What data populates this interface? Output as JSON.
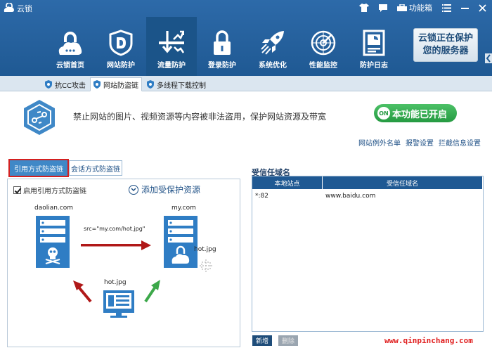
{
  "window": {
    "title": "云锁",
    "toolbox_label": "功能箱"
  },
  "nav": {
    "items": [
      {
        "label": "云锁首页",
        "icon": "cloud-lock-icon"
      },
      {
        "label": "网站防护",
        "icon": "shield-d-icon"
      },
      {
        "label": "流量防护",
        "icon": "traffic-arrows-icon"
      },
      {
        "label": "登录防护",
        "icon": "padlock-icon"
      },
      {
        "label": "系统优化",
        "icon": "rocket-icon"
      },
      {
        "label": "性能监控",
        "icon": "radar-icon"
      },
      {
        "label": "防护日志",
        "icon": "log-document-icon"
      }
    ],
    "active_index": 2
  },
  "protect_badge": {
    "line1": "云锁正在保护",
    "line2": "您的服务器"
  },
  "subtabs": [
    {
      "label": "抗CC攻击",
      "active": false
    },
    {
      "label": "网站防盗链",
      "active": true
    },
    {
      "label": "多线程下载控制",
      "active": false
    }
  ],
  "feature": {
    "description": "禁止网站的图片、视频资源等内容被非法盗用，保护网站资源及带宽",
    "toggle_badge": "ON",
    "toggle_label": "本功能已开启"
  },
  "links": {
    "whitelist": "网站例外名单",
    "alert_settings": "报警设置",
    "block_settings": "拦截信息设置"
  },
  "left_tabs": {
    "active": "引用方式防盗链",
    "inactive": "会话方式防盗链"
  },
  "left_panel": {
    "checkbox_label": "启用引用方式防盗链",
    "add_resource_label": "添加受保护资源",
    "diagram": {
      "site_a": "daolian.com",
      "site_b": "my.com",
      "src_text": "src=\"my.com/hot.jpg\"",
      "file_b": "hot.jpg",
      "file_bottom": "hot.jpg"
    }
  },
  "right_panel": {
    "title": "受信任域名",
    "columns": [
      "本地站点",
      "受信任域名"
    ],
    "rows": [
      {
        "local": "*:82",
        "trusted": "www.baidu.com"
      }
    ],
    "add_button": "新增",
    "delete_button": "删除"
  },
  "watermark": "www.qinpinchang.com",
  "colors": {
    "header_blue": "#2d6aa9",
    "accent_blue": "#3f88c7",
    "toggle_green": "#259a41",
    "arrow_red": "#b01818",
    "arrow_green": "#3ca84a",
    "server_blue": "#2f7dc4"
  }
}
